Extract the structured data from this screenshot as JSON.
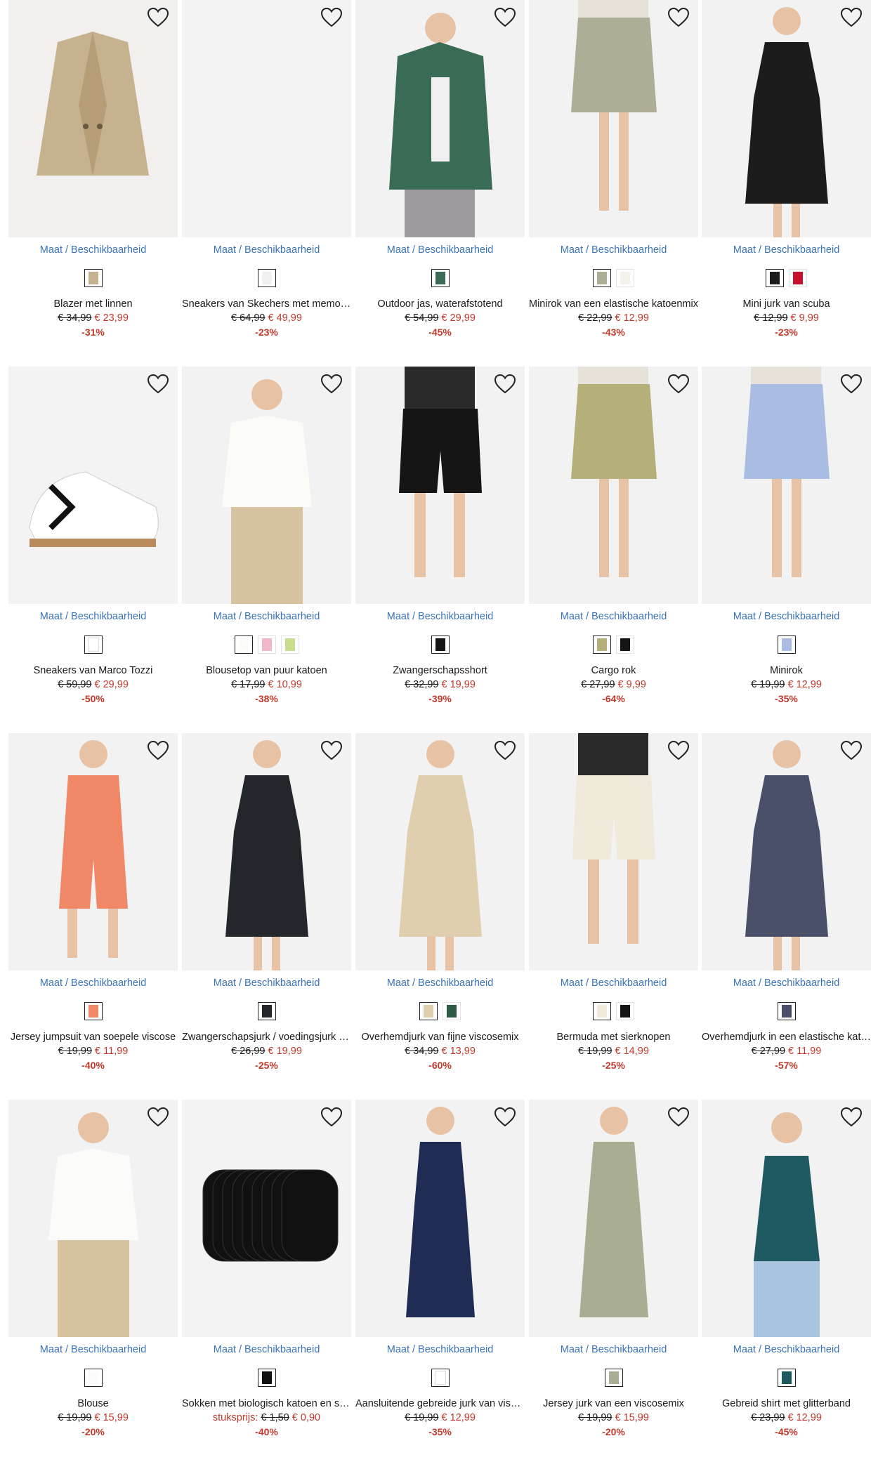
{
  "common": {
    "availability_label": "Maat / Beschikbaarheid"
  },
  "products": [
    {
      "name": "Blazer met linnen",
      "old_price": "€ 34,99",
      "new_price": "€ 23,99",
      "discount": "-31%",
      "bg": "#f1f0ee",
      "item": "#c6b28f",
      "kind": "blazer",
      "swatches": [
        "#c6b28f"
      ]
    },
    {
      "name": "Sneakers van Skechers met memory foam",
      "old_price": "€ 64,99",
      "new_price": "€ 49,99",
      "discount": "-23%",
      "bg": "#f3f3f3",
      "item": "#f6f6f6",
      "kind": "blank",
      "swatches": [
        "#f0f0f0"
      ]
    },
    {
      "name": "Outdoor jas, waterafstotend",
      "old_price": "€ 54,99",
      "new_price": "€ 29,99",
      "discount": "-45%",
      "bg": "#f2f2f2",
      "item": "#3a6b55",
      "kind": "jacket",
      "swatches": [
        "#3a6b55"
      ]
    },
    {
      "name": "Minirok van een elastische katoenmix",
      "old_price": "€ 22,99",
      "new_price": "€ 12,99",
      "discount": "-43%",
      "bg": "#f2f2f2",
      "item": "#aeae97",
      "kind": "skirt",
      "swatches": [
        "#aeae97",
        "#f4f2ea"
      ]
    },
    {
      "name": "Mini jurk van scuba",
      "old_price": "€ 12,99",
      "new_price": "€ 9,99",
      "discount": "-23%",
      "bg": "#f2f2f2",
      "item": "#1c1c1c",
      "kind": "dress",
      "swatches": [
        "#1c1c1c",
        "#c8102e"
      ]
    },
    {
      "name": "Sneakers van Marco Tozzi",
      "old_price": "€ 59,99",
      "new_price": "€ 29,99",
      "discount": "-50%",
      "bg": "#f3f3f3",
      "item": "#ffffff",
      "kind": "sneaker",
      "swatches": [
        "#ffffff"
      ]
    },
    {
      "name": "Blousetop van puur katoen",
      "old_price": "€ 17,99",
      "new_price": "€ 10,99",
      "discount": "-38%",
      "bg": "#f2f2f2",
      "item": "#fbfbf8",
      "kind": "top",
      "swatches": [
        "#fbfbf8",
        "#f1b8c9",
        "#c8de8e"
      ]
    },
    {
      "name": "Zwangerschapsshort",
      "old_price": "€ 32,99",
      "new_price": "€ 19,99",
      "discount": "-39%",
      "bg": "#f2f2f2",
      "item": "#151515",
      "kind": "shorts",
      "swatches": [
        "#151515"
      ]
    },
    {
      "name": "Cargo rok",
      "old_price": "€ 27,99",
      "new_price": "€ 9,99",
      "discount": "-64%",
      "bg": "#f2f2f2",
      "item": "#b5b07a",
      "kind": "skirt",
      "swatches": [
        "#b5b07a",
        "#151515"
      ]
    },
    {
      "name": "Minirok",
      "old_price": "€ 19,99",
      "new_price": "€ 12,99",
      "discount": "-35%",
      "bg": "#f2f2f2",
      "item": "#a9bde2",
      "kind": "skirt",
      "swatches": [
        "#a9bde2"
      ]
    },
    {
      "name": "Jersey jumpsuit van soepele viscose",
      "old_price": "€ 19,99",
      "new_price": "€ 11,99",
      "discount": "-40%",
      "bg": "#f2f2f2",
      "item": "#f08868",
      "kind": "jumpsuit",
      "swatches": [
        "#f08868"
      ]
    },
    {
      "name": "Zwangerschapsjurk / voedingsjurk met bloemenprint",
      "old_price": "€ 26,99",
      "new_price": "€ 19,99",
      "discount": "-25%",
      "bg": "#f2f2f2",
      "item": "#23262b",
      "kind": "dress",
      "swatches": [
        "#23262b"
      ]
    },
    {
      "name": "Overhemdjurk van fijne viscosemix",
      "old_price": "€ 34,99",
      "new_price": "€ 13,99",
      "discount": "-60%",
      "bg": "#f2f2f2",
      "item": "#dfcfae",
      "kind": "dress",
      "swatches": [
        "#dfcfae",
        "#2f5a45"
      ]
    },
    {
      "name": "Bermuda met sierknopen",
      "old_price": "€ 19,99",
      "new_price": "€ 14,99",
      "discount": "-25%",
      "bg": "#f2f2f2",
      "item": "#efeadb",
      "kind": "shorts",
      "swatches": [
        "#efeadb",
        "#151515"
      ]
    },
    {
      "name": "Overhemdjurk in een elastische katoenmix",
      "old_price": "€ 27,99",
      "new_price": "€ 11,99",
      "discount": "-57%",
      "bg": "#f2f2f2",
      "item": "#4a4f6a",
      "kind": "dress",
      "swatches": [
        "#4a4f6a"
      ]
    },
    {
      "name": "Blouse",
      "old_price": "€ 19,99",
      "new_price": "€ 15,99",
      "discount": "-20%",
      "bg": "#f2f2f2",
      "item": "#fbfbfa",
      "kind": "top",
      "swatches": [
        "#fbfbfa"
      ]
    },
    {
      "name": "Sokken met biologisch katoen en silver",
      "unit_label": "stuksprijs:",
      "old_price": "€ 1,50",
      "new_price": "€ 0,90",
      "discount": "-40%",
      "bg": "#f3f3f3",
      "item": "#111111",
      "kind": "socks",
      "swatches": [
        "#111111"
      ]
    },
    {
      "name": "Aansluitende gebreide jurk van viscose",
      "old_price": "€ 19,99",
      "new_price": "€ 12,99",
      "discount": "-35%",
      "bg": "#f2f2f2",
      "item": "#1f2d55",
      "kind": "longdress",
      "swatches": [
        "#ffffff"
      ]
    },
    {
      "name": "Jersey jurk van een viscosemix",
      "old_price": "€ 19,99",
      "new_price": "€ 15,99",
      "discount": "-20%",
      "bg": "#f2f2f2",
      "item": "#a9ad92",
      "kind": "longdress",
      "swatches": [
        "#a9ad92"
      ]
    },
    {
      "name": "Gebreid shirt met glitterband",
      "old_price": "€ 23,99",
      "new_price": "€ 12,99",
      "discount": "-45%",
      "bg": "#f2f2f2",
      "item": "#1f5a63",
      "kind": "tank",
      "swatches": [
        "#1f5a63"
      ]
    }
  ]
}
